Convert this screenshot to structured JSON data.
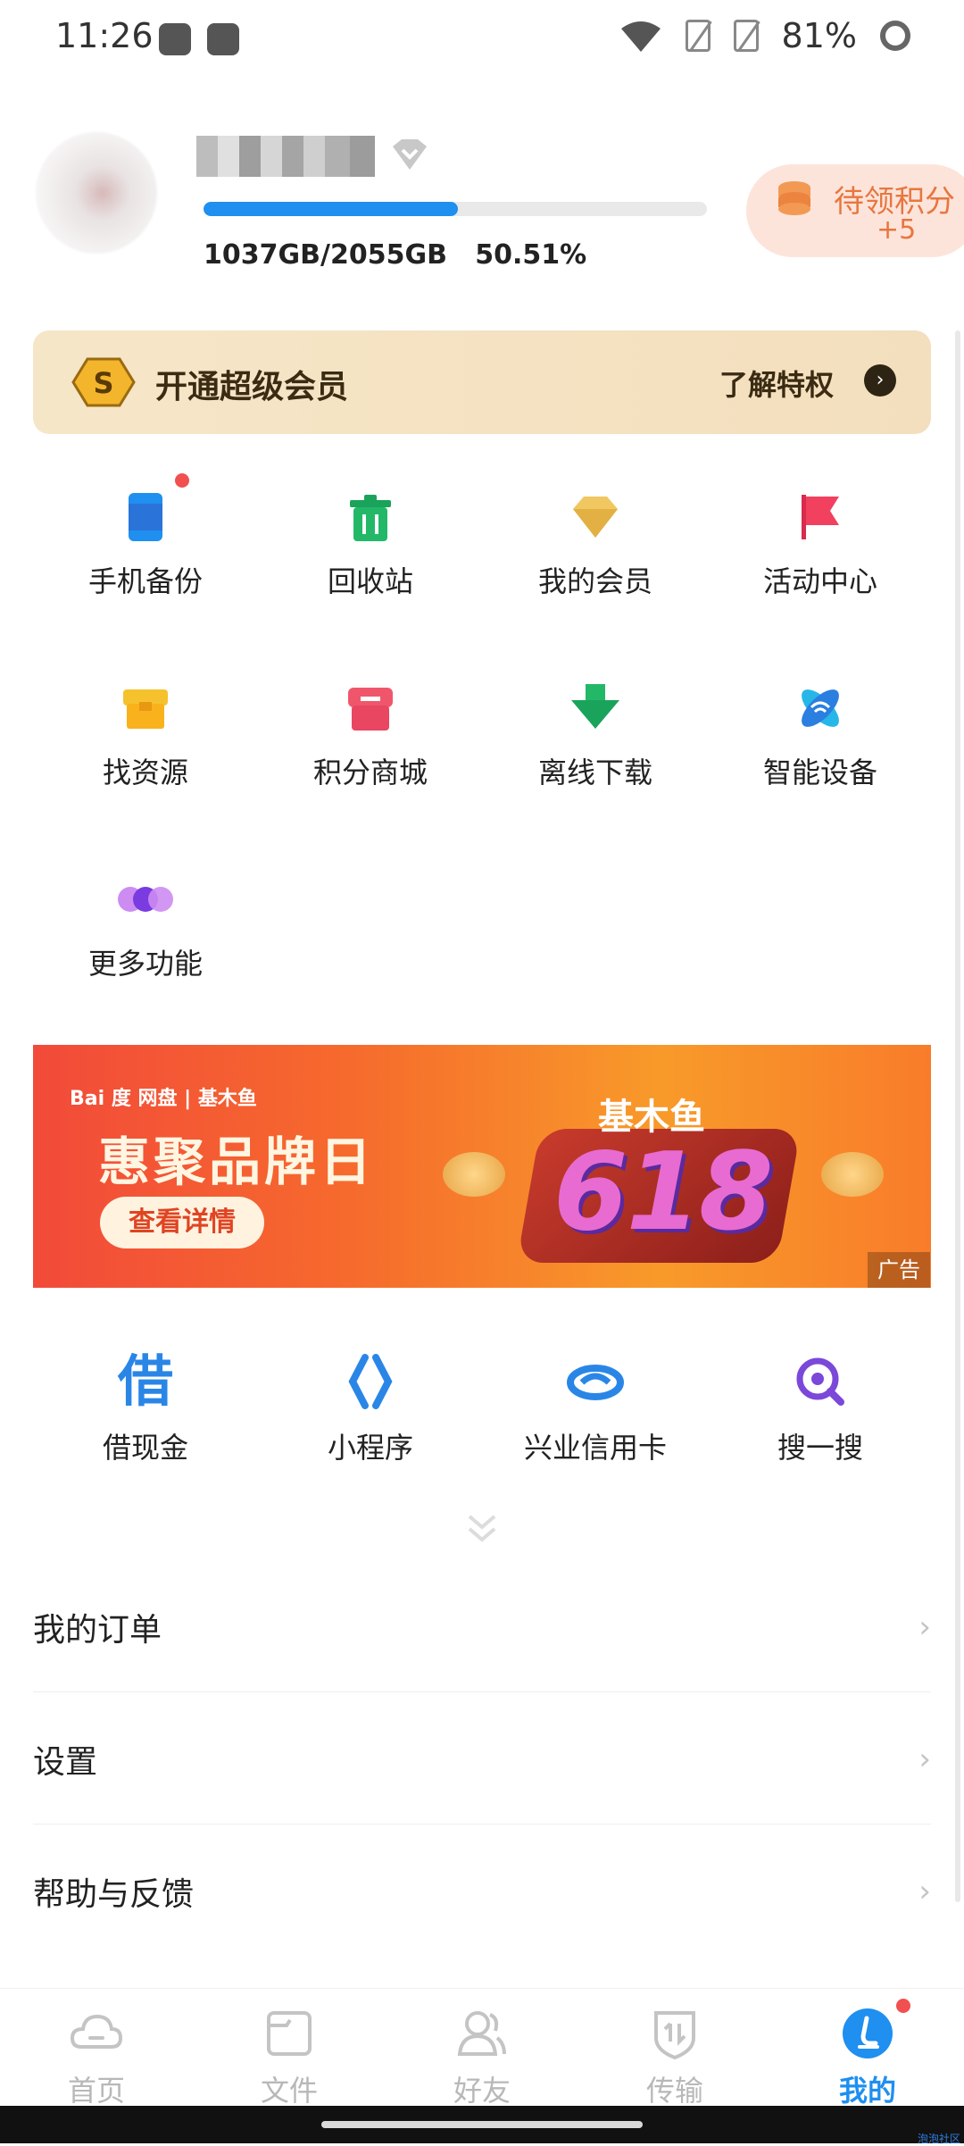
{
  "status_bar": {
    "time": "11:26",
    "battery": "81%"
  },
  "profile": {
    "storage_text": "1037GB/2055GB",
    "storage_percent": "50.51%",
    "storage_fraction": 0.5051,
    "points_label": "待领积分",
    "points_value": "+5"
  },
  "vip_banner": {
    "title": "开通超级会员",
    "link_label": "了解特权"
  },
  "grid": [
    {
      "label": "手机备份",
      "icon": "phone-backup-icon"
    },
    {
      "label": "回收站",
      "icon": "trash-icon"
    },
    {
      "label": "我的会员",
      "icon": "diamond-icon"
    },
    {
      "label": "活动中心",
      "icon": "flag-icon"
    },
    {
      "label": "找资源",
      "icon": "resource-box-icon"
    },
    {
      "label": "积分商城",
      "icon": "store-icon"
    },
    {
      "label": "离线下载",
      "icon": "download-arrow-icon"
    },
    {
      "label": "智能设备",
      "icon": "smart-device-icon"
    },
    {
      "label": "更多功能",
      "icon": "more-dots-icon"
    }
  ],
  "ad": {
    "brand": "Bai 度 网盘 | 基木鱼",
    "title": "惠聚品牌日",
    "button": "查看详情",
    "brand2": "基木鱼",
    "number": "618",
    "tag": "广告"
  },
  "services": [
    {
      "label": "借现金",
      "icon": "loan-icon"
    },
    {
      "label": "小程序",
      "icon": "mini-program-icon"
    },
    {
      "label": "兴业信用卡",
      "icon": "credit-card-icon"
    },
    {
      "label": "搜一搜",
      "icon": "search-icon"
    }
  ],
  "menu": [
    {
      "label": "我的订单"
    },
    {
      "label": "设置"
    },
    {
      "label": "帮助与反馈"
    }
  ],
  "bottom_nav": [
    {
      "label": "首页",
      "icon": "cloud-icon",
      "active": false
    },
    {
      "label": "文件",
      "icon": "folder-icon",
      "active": false
    },
    {
      "label": "好友",
      "icon": "friends-icon",
      "active": false
    },
    {
      "label": "传输",
      "icon": "transfer-icon",
      "active": false
    },
    {
      "label": "我的",
      "icon": "profile-icon",
      "active": true
    }
  ],
  "watermark": "泡泡社区",
  "colors": {
    "accent": "#1f8ff0",
    "points": "#e8763f",
    "vip_bg": "#f6e6c8",
    "badge_red": "#f25050"
  }
}
